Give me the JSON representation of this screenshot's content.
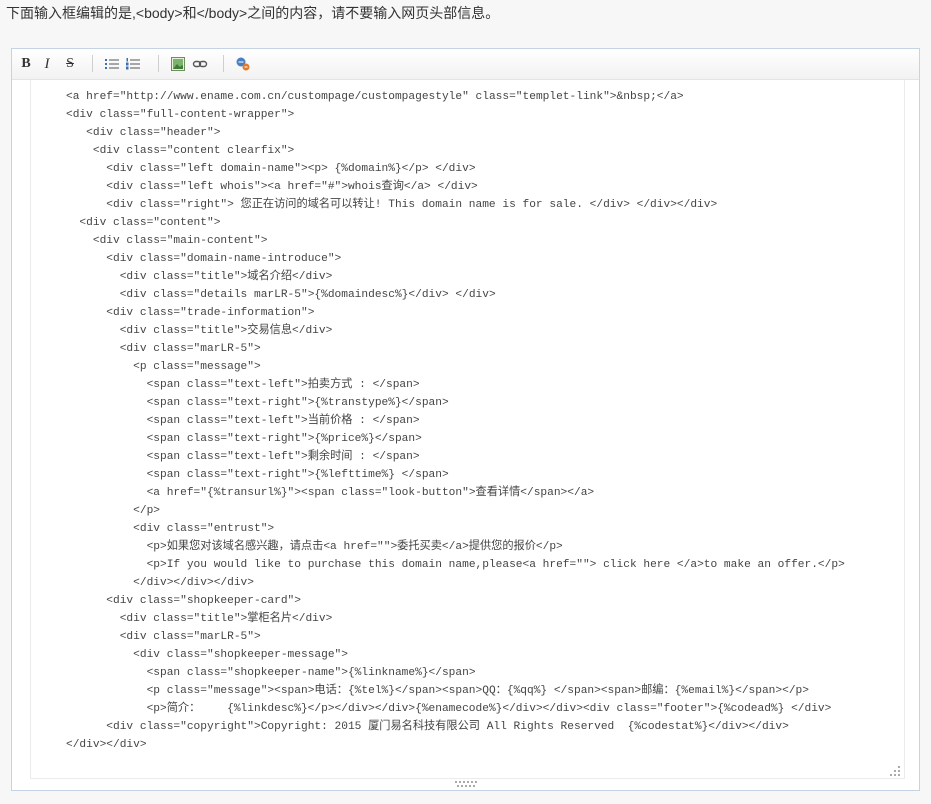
{
  "hint": "下面输入框编辑的是,<body>和</body>之间的内容，请不要输入网页头部信息。",
  "toolbar": {
    "bold_label": "B",
    "italic_label": "I",
    "strike_label": "S",
    "icons": [
      "bold-icon",
      "italic-icon",
      "strikethrough-icon",
      "unordered-list-icon",
      "ordered-list-icon",
      "image-icon",
      "link-icon",
      "html-source-icon"
    ]
  },
  "editor": {
    "code_lines": [
      "<a href=\"http://www.ename.com.cn/custompage/custompagestyle\" class=\"templet-link\">&nbsp;</a>",
      "<div class=\"full-content-wrapper\">",
      "   <div class=\"header\">",
      "    <div class=\"content clearfix\">",
      "      <div class=\"left domain-name\"><p> {%domain%}</p> </div>",
      "      <div class=\"left whois\"><a href=\"#\">whois查询</a> </div>",
      "      <div class=\"right\"> 您正在访问的域名可以转让! This domain name is for sale. </div> </div></div>",
      "  <div class=\"content\">",
      "    <div class=\"main-content\">",
      "      <div class=\"domain-name-introduce\">",
      "        <div class=\"title\">域名介绍</div>",
      "        <div class=\"details marLR-5\">{%domaindesc%}</div> </div>",
      "      <div class=\"trade-information\">",
      "        <div class=\"title\">交易信息</div>",
      "        <div class=\"marLR-5\">",
      "          <p class=\"message\">",
      "            <span class=\"text-left\">拍卖方式 : </span>",
      "            <span class=\"text-right\">{%transtype%}</span>",
      "            <span class=\"text-left\">当前价格 : </span>",
      "            <span class=\"text-right\">{%price%}</span>",
      "            <span class=\"text-left\">剩余时间 : </span>",
      "            <span class=\"text-right\">{%lefttime%} </span>",
      "            <a href=\"{%transurl%}\"><span class=\"look-button\">查看详情</span></a>",
      "          </p>",
      "          <div class=\"entrust\">",
      "            <p>如果您对该域名感兴趣，请点击<a href=\"\">委托买卖</a>提供您的报价</p>",
      "            <p>If you would like to purchase this domain name,please<a href=\"\"> click here </a>to make an offer.</p>",
      "          </div></div></div>",
      "      <div class=\"shopkeeper-card\">",
      "        <div class=\"title\">掌柜名片</div>",
      "        <div class=\"marLR-5\">",
      "          <div class=\"shopkeeper-message\">",
      "            <span class=\"shopkeeper-name\">{%linkname%}</span>",
      "            <p class=\"message\"><span>电话：{%tel%}</span><span>QQ：{%qq%} </span><span>邮编：{%email%}</span></p>",
      "            <p>简介：    {%linkdesc%}</p></div></div>{%enamecode%}</div></div><div class=\"footer\">{%codead%} </div>",
      "      <div class=\"copyright\">Copyright: 2015 厦门易名科技有限公司 All Rights Reserved  {%codestat%}</div></div>",
      "</div></div>"
    ]
  },
  "colors": {
    "page_bg": "#f7f7f7",
    "editor_border": "#c5d4e4",
    "code_text": "#444444"
  }
}
